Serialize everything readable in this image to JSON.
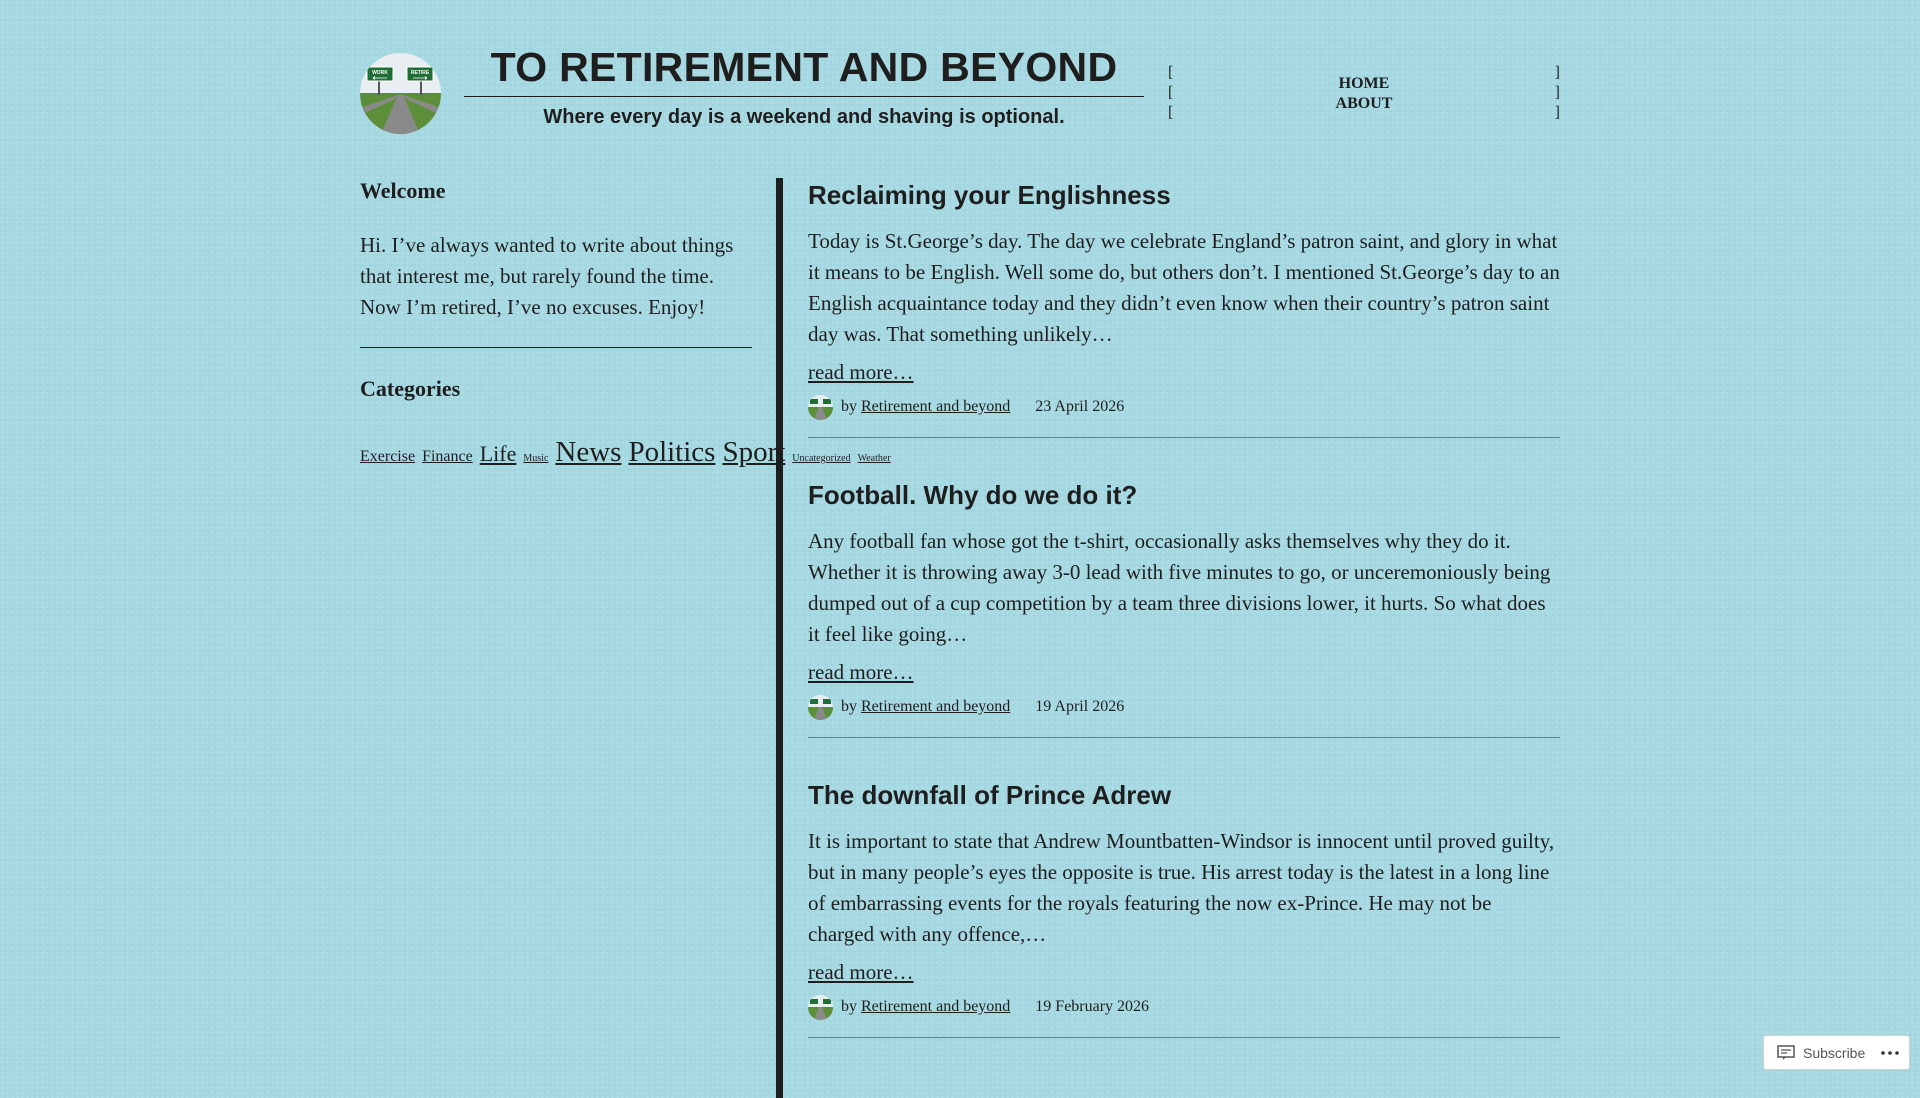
{
  "site": {
    "title": "TO RETIREMENT AND BEYOND",
    "tagline": "Where every day is a weekend and shaving is optional.",
    "logo_sign_left": "WORK",
    "logo_sign_right": "RETIRE"
  },
  "nav": {
    "bracket_open": "[",
    "bracket_close": "]",
    "items": [
      {
        "label": "HOME"
      },
      {
        "label": "ABOUT"
      }
    ]
  },
  "sidebar": {
    "welcome_title": "Welcome",
    "welcome_text": "Hi. I’ve always wanted to write about things that interest me, but rarely found the time. Now I’m retired, I’ve no excuses. Enjoy!",
    "categories_title": "Categories",
    "categories": [
      {
        "label": "Exercise"
      },
      {
        "label": "Finance"
      },
      {
        "label": "Life"
      },
      {
        "label": "Music"
      },
      {
        "label": "News"
      },
      {
        "label": "Politics"
      },
      {
        "label": "Sport"
      },
      {
        "label": "Uncategorized"
      },
      {
        "label": "Weather"
      }
    ]
  },
  "posts": [
    {
      "title": "Reclaiming your Englishness",
      "excerpt": "Today is St.George’s day. The day we celebrate England’s patron saint, and glory in what it means to be English. Well some do, but others don’t. I mentioned St.George’s day to an English acquaintance today and they didn’t even know when their country’s patron saint day was. That something unlikely…",
      "read_more": "read more…",
      "by": "by",
      "author": "Retirement and beyond",
      "date": "23 April 2026"
    },
    {
      "title": "Football. Why do we do it?",
      "excerpt": "Any football fan whose got the t-shirt, occasionally asks themselves why they do it. Whether it is throwing away 3-0 lead with five minutes to go, or unceremoniously being dumped out of a cup competition by a team three divisions lower, it hurts. So what does it feel like going…",
      "read_more": "read more…",
      "by": "by",
      "author": "Retirement and beyond",
      "date": "19 April 2026"
    },
    {
      "title": "The downfall of Prince Adrew",
      "excerpt": "It is important to state that Andrew Mountbatten-Windsor is innocent until proved guilty, but in many people’s eyes the opposite is true. His arrest today is the latest in a long line of embarrassing events for the royals featuring the now ex-Prince. He may not be charged with any offence,…",
      "read_more": "read more…",
      "by": "by",
      "author": "Retirement and beyond",
      "date": "19 February 2026"
    }
  ],
  "subscribe": {
    "label": "Subscribe",
    "more_icon": "ellipsis-icon"
  },
  "colors": {
    "background": "#a6d8e2",
    "text": "#1e1e1e",
    "sign_green": "#1f6e35"
  }
}
